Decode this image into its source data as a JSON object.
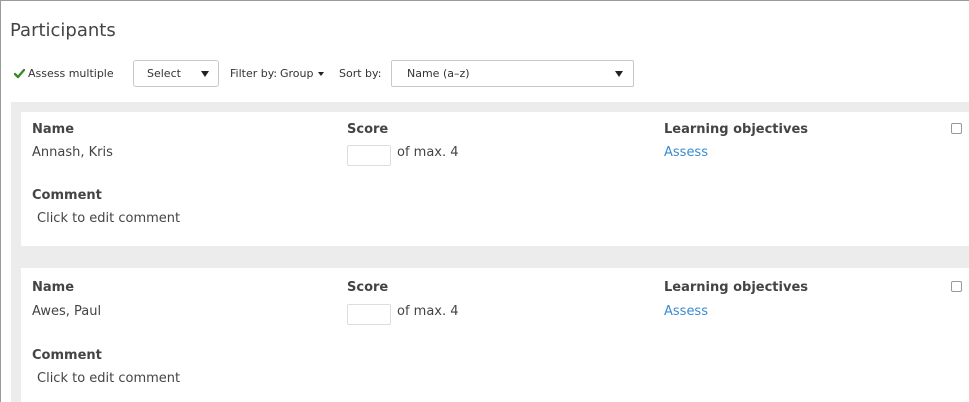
{
  "page": {
    "title": "Participants"
  },
  "toolbar": {
    "assess_multiple_label": "Assess multiple",
    "select_label": "Select",
    "filter_label": "Filter by:",
    "group_label": "Group",
    "sort_label": "Sort by:",
    "sort_value": "Name (a–z)"
  },
  "labels": {
    "name": "Name",
    "score": "Score",
    "learning_objectives": "Learning objectives",
    "comment": "Comment"
  },
  "participants": [
    {
      "name": "Annash, Kris",
      "score_value": "",
      "score_suffix": "of max. 4",
      "objectives_link": "Assess",
      "comment": "Click to edit comment"
    },
    {
      "name": "Awes, Paul",
      "score_value": "",
      "score_suffix": "of max. 4",
      "objectives_link": "Assess",
      "comment": "Click to edit comment"
    }
  ],
  "colors": {
    "link": "#3a8bd0",
    "check_icon": "#3a8a2a",
    "panel_bg": "#ececec"
  },
  "icons": {
    "assess_multiple": "check-icon",
    "dropdown": "caret-down-icon"
  }
}
